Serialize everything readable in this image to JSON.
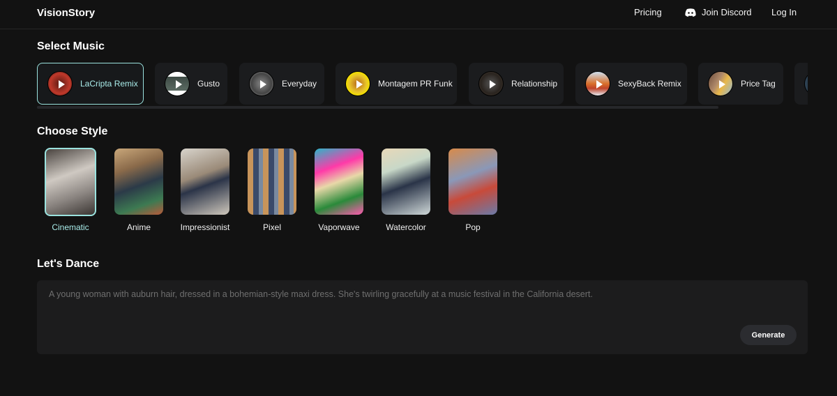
{
  "header": {
    "logo": "VisionStory",
    "pricing": "Pricing",
    "discord": "Join Discord",
    "login": "Log In"
  },
  "sections": {
    "music": "Select Music",
    "style": "Choose Style",
    "dance": "Let's Dance"
  },
  "music": [
    {
      "label": "LaCripta Remix",
      "selected": true
    },
    {
      "label": "Gusto"
    },
    {
      "label": "Everyday"
    },
    {
      "label": "Montagem PR Funk"
    },
    {
      "label": "Relationship"
    },
    {
      "label": "SexyBack Remix"
    },
    {
      "label": "Price Tag"
    }
  ],
  "styles": [
    {
      "label": "Cinematic",
      "selected": true
    },
    {
      "label": "Anime"
    },
    {
      "label": "Impressionist"
    },
    {
      "label": "Pixel"
    },
    {
      "label": "Vaporwave"
    },
    {
      "label": "Watercolor"
    },
    {
      "label": "Pop"
    }
  ],
  "prompt": {
    "placeholder": "A young woman with auburn hair, dressed in a bohemian-style maxi dress. She's twirling gracefully at a music festival in the California desert.",
    "generate": "Generate"
  },
  "colors": {
    "accent": "#9be3df",
    "background": "#121212"
  }
}
